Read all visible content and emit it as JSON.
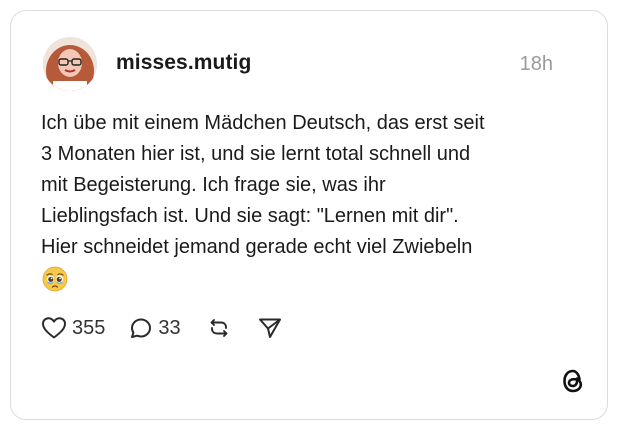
{
  "post": {
    "username": "misses.mutig",
    "timestamp": "18h",
    "text": "Ich übe mit einem Mädchen Deutsch, das erst seit\n3 Monaten hier ist, und sie lernt total schnell und\nmit Begeisterung. Ich frage sie, was ihr\nLieblingsfach ist. Und sie sagt: \"Lernen mit dir\".\nHier schneidet jemand gerade echt viel Zwiebeln",
    "emoji": "pleading-face-with-tears-icon"
  },
  "actions": {
    "likes": "355",
    "replies": "33",
    "icons": [
      "heart-icon",
      "comment-icon",
      "repost-icon",
      "share-icon"
    ]
  },
  "branding": {
    "logo": "threads-logo-icon"
  },
  "colors": {
    "text": "#1a1a1a",
    "muted": "#9a9a9a",
    "border": "#dcdcdc",
    "emoji_yellow": "#f7c84a"
  }
}
